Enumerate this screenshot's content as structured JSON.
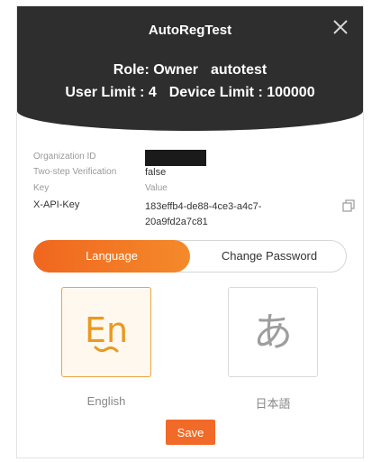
{
  "dialog": {
    "title": "AutoRegTest",
    "role_label": "Role: Owner",
    "role_user": "autotest",
    "user_limit": "User Limit : 4",
    "device_limit": "Device Limit : 100000",
    "close_icon": "close-icon"
  },
  "info": {
    "org_id_label": "Organization ID",
    "two_step_label": "Two-step Verification",
    "two_step_value": "false",
    "key_header": "Key",
    "value_header": "Value",
    "key_name": "X-API-Key",
    "key_value_line1": "183effb4-de88-4ce3-a4c7-",
    "key_value_line2": "20a9fd2a7c81",
    "copy_icon": "copy-icon"
  },
  "tabs": {
    "language": "Language",
    "change_password": "Change Password",
    "active": "language"
  },
  "languages": {
    "english_glyph": "En",
    "english_label": "English",
    "japanese_glyph": "あ",
    "japanese_label": "日本語",
    "selected": "english"
  },
  "actions": {
    "save_label": "Save"
  },
  "colors": {
    "accent": "#f26a27",
    "header_bg": "#2e2e2e",
    "selected_border": "#e9a545"
  }
}
